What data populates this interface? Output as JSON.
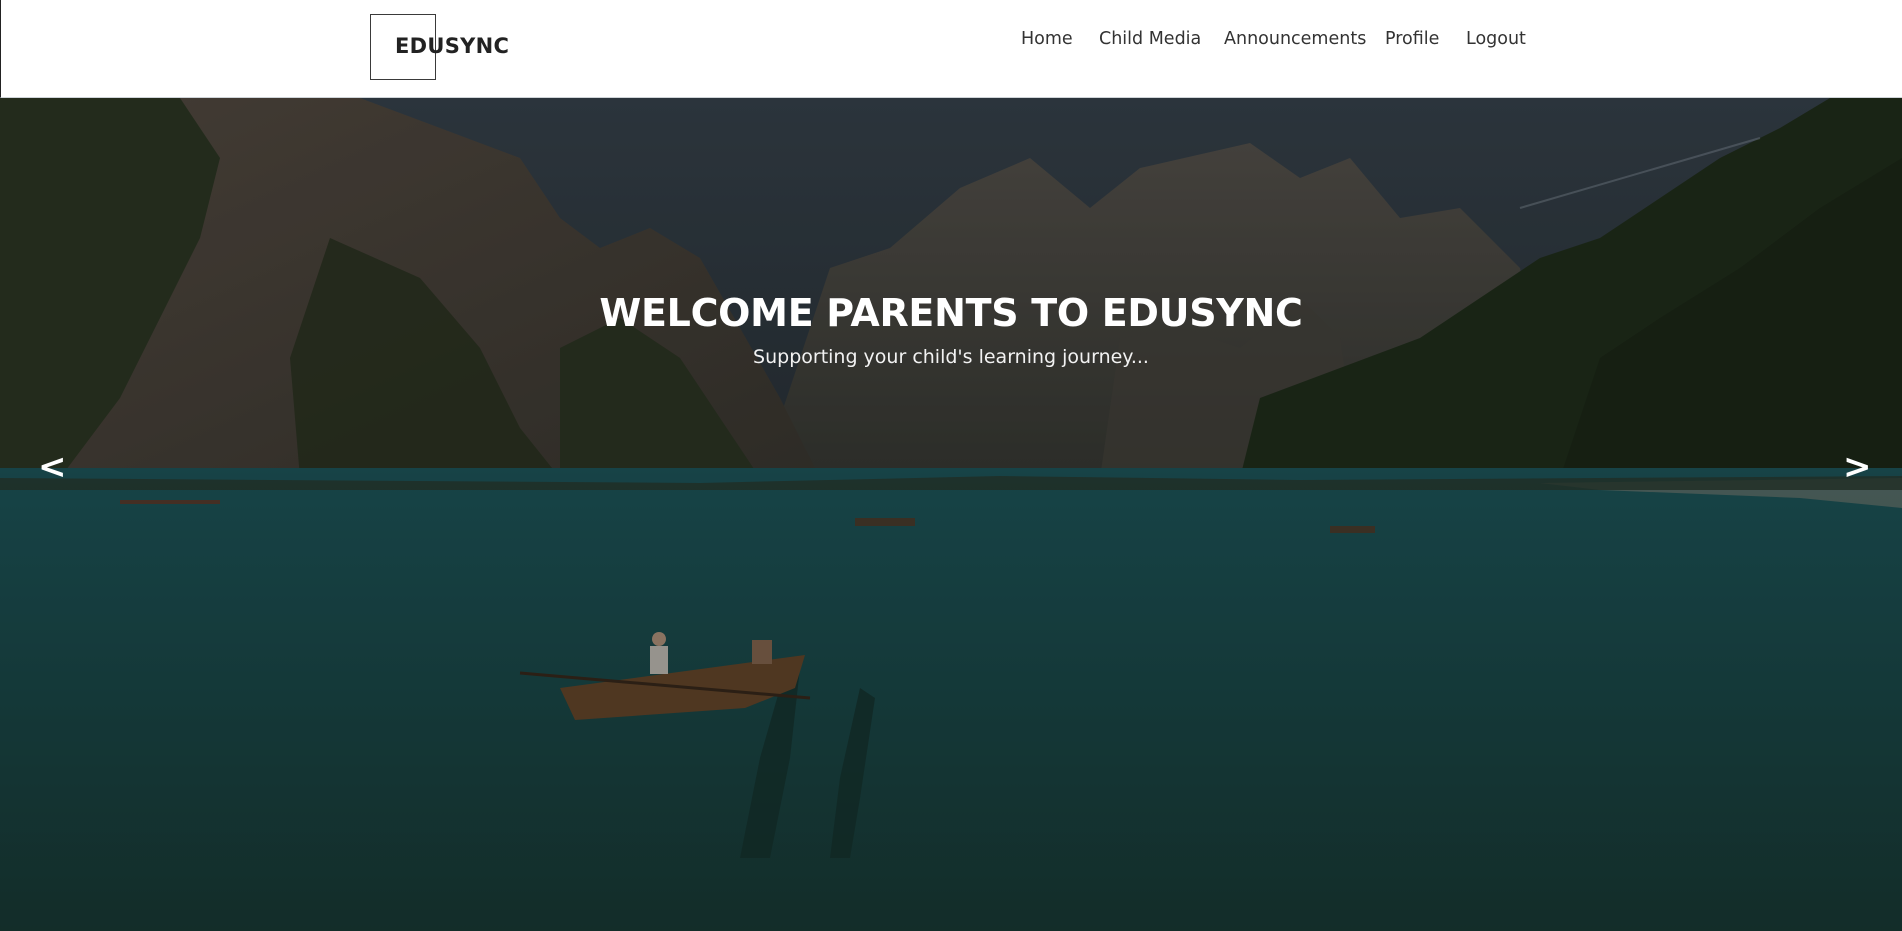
{
  "brand": {
    "logo_text": "EDUSYNC"
  },
  "nav": {
    "items": [
      {
        "label": "Home"
      },
      {
        "label": "Child Media"
      },
      {
        "label": "Announcements"
      },
      {
        "label": "Profile"
      },
      {
        "label": "Logout"
      }
    ]
  },
  "hero": {
    "title": "WELCOME PARENTS TO EDUSYNC",
    "subtitle": "Supporting your child's learning journey...",
    "prev_label": "<",
    "next_label": ">"
  }
}
